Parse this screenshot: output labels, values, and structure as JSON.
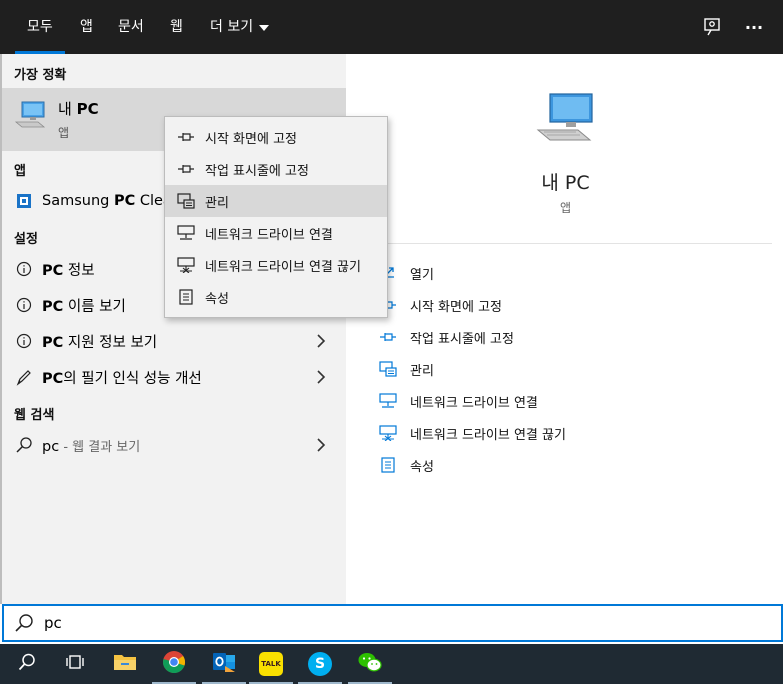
{
  "tabs": [
    {
      "label": "모두",
      "active": true
    },
    {
      "label": "앱"
    },
    {
      "label": "문서"
    },
    {
      "label": "웹"
    },
    {
      "label": "더 보기"
    }
  ],
  "top_icons": [
    "feedback-icon",
    "more-options-icon"
  ],
  "more_options_glyph": "···",
  "best_match": {
    "header": "가장 정확",
    "title_prefix": "내 ",
    "title_bold": "PC",
    "subtitle": "앱",
    "icon": "computer-icon"
  },
  "apps": {
    "header": "앱",
    "items": [
      {
        "prefix": "Samsung ",
        "bold": "PC",
        "suffix": " Clea",
        "icon": "samsung-app-icon"
      }
    ]
  },
  "settings": {
    "header": "설정",
    "items": [
      {
        "bold": "PC",
        "suffix": " 정보",
        "icon": "info-icon",
        "has_chevron": false
      },
      {
        "bold": "PC",
        "suffix": " 이름 보기",
        "icon": "info-icon",
        "has_chevron": false
      },
      {
        "bold": "PC",
        "suffix": " 지원 정보 보기",
        "icon": "info-icon",
        "has_chevron": true
      },
      {
        "bold": "PC",
        "suffix": "의 필기 인식 성능 개선",
        "icon": "pen-icon",
        "has_chevron": true
      }
    ]
  },
  "web": {
    "header": "웹 검색",
    "query": "pc",
    "suffix": " - 웹 결과 보기",
    "icon": "search-icon"
  },
  "context_menu": [
    {
      "label": "시작 화면에 고정",
      "icon": "pin-icon"
    },
    {
      "label": "작업 표시줄에 고정",
      "icon": "pin-icon"
    },
    {
      "label": "관리",
      "icon": "manage-icon",
      "hovered": true
    },
    {
      "label": "네트워크 드라이브 연결",
      "icon": "network-drive-icon"
    },
    {
      "label": "네트워크 드라이브 연결 끊기",
      "icon": "network-drive-disconnect-icon"
    },
    {
      "label": "속성",
      "icon": "properties-icon"
    }
  ],
  "right_pane": {
    "title": "내 PC",
    "subtitle": "앱",
    "actions": [
      {
        "label": "열기",
        "icon": "open-icon"
      },
      {
        "label": "시작 화면에 고정",
        "icon": "pin-icon"
      },
      {
        "label": "작업 표시줄에 고정",
        "icon": "pin-icon"
      },
      {
        "label": "관리",
        "icon": "manage-icon"
      },
      {
        "label": "네트워크 드라이브 연결",
        "icon": "network-drive-icon"
      },
      {
        "label": "네트워크 드라이브 연결 끊기",
        "icon": "network-drive-disconnect-icon"
      },
      {
        "label": "속성",
        "icon": "properties-icon"
      }
    ]
  },
  "search": {
    "value": "pc"
  },
  "taskbar": [
    {
      "icon": "search-icon"
    },
    {
      "icon": "task-view-icon"
    },
    {
      "icon": "file-explorer-icon"
    },
    {
      "icon": "chrome-icon",
      "running": true
    },
    {
      "icon": "outlook-icon",
      "running": true
    },
    {
      "icon": "kakaotalk-icon",
      "running": true,
      "text": "TALK"
    },
    {
      "icon": "skype-icon",
      "running": true,
      "text": "S"
    },
    {
      "icon": "wechat-icon",
      "running": true
    }
  ],
  "colors": {
    "accent": "#0078d7",
    "topbar": "#1f1f1f",
    "taskbar": "#1f2a33",
    "left_pane": "#f2f2f2"
  }
}
